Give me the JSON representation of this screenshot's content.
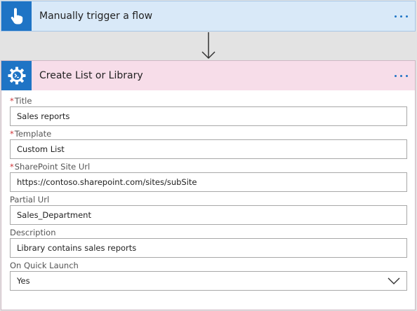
{
  "trigger": {
    "title": "Manually trigger a flow",
    "icon": "touch-hand-icon"
  },
  "action": {
    "title": "Create List or Library",
    "icon": "gear-icon",
    "fields": [
      {
        "label": "Title",
        "required": true,
        "value": "Sales reports"
      },
      {
        "label": "Template",
        "required": true,
        "value": "Custom List"
      },
      {
        "label": "SharePoint Site Url",
        "required": true,
        "value": "https://contoso.sharepoint.com/sites/subSite"
      },
      {
        "label": "Partial Url",
        "required": false,
        "value": "Sales_Department"
      },
      {
        "label": "Description",
        "required": false,
        "value": "Library contains sales reports"
      }
    ],
    "quick_launch": {
      "label": "On Quick Launch",
      "value": "Yes"
    }
  },
  "required_marker": "*",
  "colors": {
    "accent": "#1f74c5",
    "trigger_header": "#d9e9f8",
    "action_header": "#f7dde9",
    "canvas": "#e3e3e3"
  }
}
